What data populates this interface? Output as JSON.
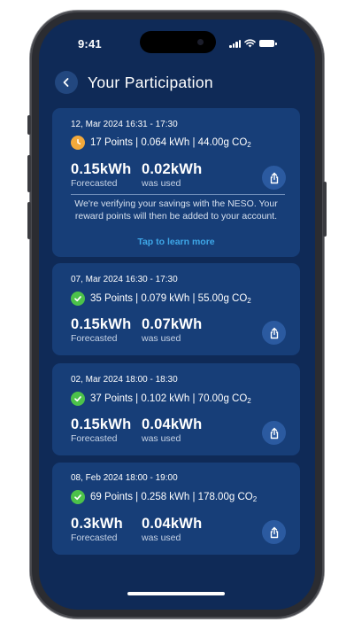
{
  "status_bar": {
    "time": "9:41"
  },
  "header": {
    "title": "Your Participation"
  },
  "cards": [
    {
      "date": "12, Mar 2024 16:31 - 17:30",
      "status": "pending",
      "points_text": "17 Points | 0.064 kWh | 44.00g CO",
      "forecast_value": "0.15kWh",
      "forecast_label": "Forecasted",
      "used_value": "0.02kWh",
      "used_label": "was used",
      "note": "We're verifying your savings with the NESO. Your reward points will then be added to your account.",
      "link": "Tap to learn more"
    },
    {
      "date": "07, Mar 2024 16:30 - 17:30",
      "status": "verified",
      "points_text": "35 Points | 0.079 kWh | 55.00g CO",
      "forecast_value": "0.15kWh",
      "forecast_label": "Forecasted",
      "used_value": "0.07kWh",
      "used_label": "was used"
    },
    {
      "date": "02, Mar 2024 18:00 - 18:30",
      "status": "verified",
      "points_text": "37 Points | 0.102 kWh | 70.00g CO",
      "forecast_value": "0.15kWh",
      "forecast_label": "Forecasted",
      "used_value": "0.04kWh",
      "used_label": "was used"
    },
    {
      "date": "08, Feb 2024 18:00 - 19:00",
      "status": "verified",
      "points_text": "69 Points | 0.258 kWh | 178.00g CO",
      "forecast_value": "0.3kWh",
      "forecast_label": "Forecasted",
      "used_value": "0.04kWh",
      "used_label": "was used"
    }
  ],
  "co2_subscript": "2",
  "colors": {
    "background": "#0f2a57",
    "card": "#173e78",
    "pending": "#f2a93b",
    "verified": "#4cc24a",
    "link": "#3ea7e8"
  },
  "icons": {
    "back": "chevron-left-icon",
    "pending": "clock-icon",
    "verified": "check-circle-icon",
    "share": "share-icon"
  }
}
